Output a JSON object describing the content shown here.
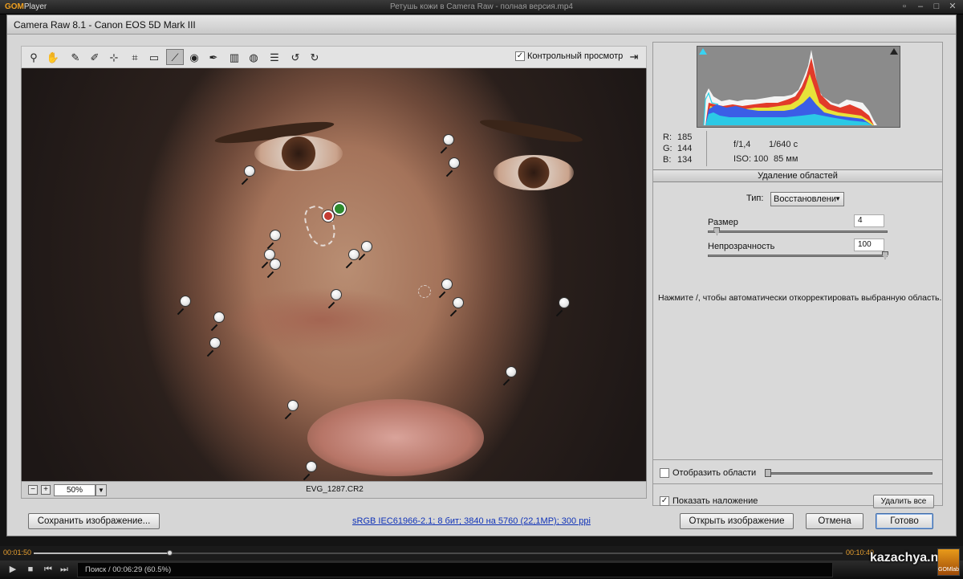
{
  "player": {
    "brand": "GOM",
    "brand_suffix": "Player",
    "file_title": "Ретушь кожи в Camera Raw - полная версия.mp4",
    "time_elapsed": "00:01:50",
    "time_total": "00:10:40",
    "progress": 0.168,
    "status": "Поиск / 00:06:29 (60.5%)",
    "watermark": "kazachya.net",
    "lab_label": "GOMlab"
  },
  "dialog": {
    "title": "Camera Raw 8.1  -  Canon EOS 5D Mark III",
    "preview_label": "Контрольный просмотр",
    "preview_checked": true,
    "zoom": "50%",
    "file_name": "EVG_1287.CR2",
    "workflow_link": "sRGB IEC61966-2.1; 8 бит; 3840 на 5760 (22,1МР); 300 ppi"
  },
  "toolbar": {
    "tools": [
      {
        "name": "zoom-tool",
        "icon": "magnifier-icon",
        "glyph": "⚲"
      },
      {
        "name": "hand-tool",
        "icon": "hand-icon",
        "glyph": "✋"
      },
      {
        "name": "white-balance-tool",
        "icon": "eyedropper-icon",
        "glyph": "✎"
      },
      {
        "name": "color-sampler-tool",
        "icon": "color-sampler-icon",
        "glyph": "✐"
      },
      {
        "name": "targeted-adjustment-tool",
        "icon": "target-adjust-icon",
        "glyph": "⊹"
      },
      {
        "name": "crop-tool",
        "icon": "crop-icon",
        "glyph": "⌗"
      },
      {
        "name": "straighten-tool",
        "icon": "straighten-icon",
        "glyph": "▭"
      },
      {
        "name": "spot-removal-tool",
        "icon": "spot-removal-icon",
        "glyph": "⟋"
      },
      {
        "name": "red-eye-tool",
        "icon": "red-eye-icon",
        "glyph": "◉"
      },
      {
        "name": "adjustment-brush-tool",
        "icon": "brush-icon",
        "glyph": "✒"
      },
      {
        "name": "graduated-filter-tool",
        "icon": "graduated-filter-icon",
        "glyph": "▥"
      },
      {
        "name": "radial-filter-tool",
        "icon": "radial-filter-icon",
        "glyph": "◍"
      },
      {
        "name": "preferences-tool",
        "icon": "list-icon",
        "glyph": "☰"
      },
      {
        "name": "rotate-left-tool",
        "icon": "rotate-left-icon",
        "glyph": "↺"
      },
      {
        "name": "rotate-right-tool",
        "icon": "rotate-right-icon",
        "glyph": "↻"
      }
    ]
  },
  "readout": {
    "r_label": "R:",
    "r": "185",
    "g_label": "G:",
    "g": "144",
    "b_label": "B:",
    "b": "134",
    "aperture": "f/1,4",
    "shutter": "1/640 с",
    "iso": "ISO: 100",
    "focal": "85 мм"
  },
  "panel": {
    "section_title": "Удаление областей",
    "type_label": "Тип:",
    "type_value": "Восстановлени",
    "size_label": "Размер",
    "size_value": "4",
    "size_level": 0.03,
    "opacity_label": "Непрозрачность",
    "opacity_value": "100",
    "opacity_level": 1.0,
    "hint": "Нажмите /, чтобы автоматически откорректировать выбранную область.",
    "visualize_label": "Отобразить области",
    "visualize_checked": false,
    "overlay_label": "Показать наложение",
    "overlay_checked": true,
    "delete_all_label": "Удалить все"
  },
  "buttons": {
    "save": "Сохранить изображение...",
    "open": "Открыть изображение",
    "cancel": "Отмена",
    "done": "Готово"
  },
  "colors": {
    "accent_blue": "#1033b8",
    "player_orange": "#e8a030",
    "heal_source": "#c43b33",
    "heal_target": "#2d8b2d"
  }
}
